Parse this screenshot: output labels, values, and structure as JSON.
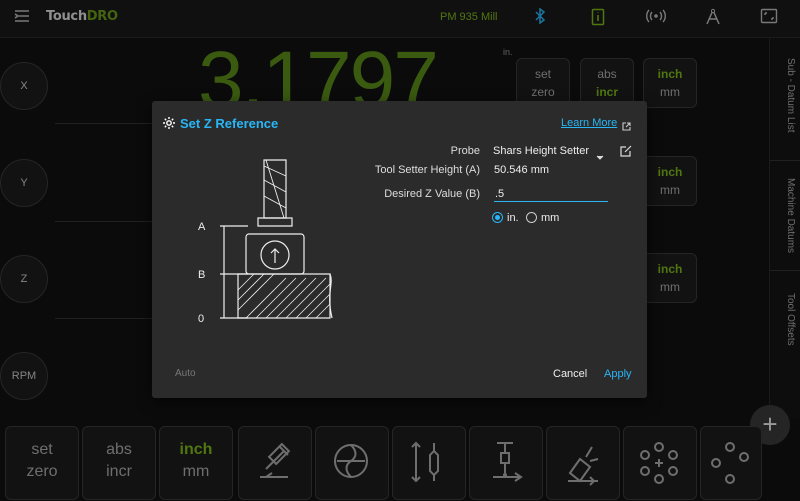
{
  "topbar": {
    "brand_main": "Touch",
    "brand_accent": "DRO",
    "machine_name": "PM 935 Mill"
  },
  "dro": {
    "axes": [
      "X",
      "Y",
      "Z",
      "RPM"
    ],
    "readout_x": "3.1797",
    "readout_unit": "in.",
    "side_buttons": [
      {
        "top": "set",
        "bottom": "zero"
      },
      {
        "top": "abs",
        "bottom": "incr"
      },
      {
        "top": "inch",
        "bottom": "mm"
      }
    ]
  },
  "rail": {
    "items": [
      "Sub - Datum List",
      "Machine Datums",
      "Tool Offsets"
    ]
  },
  "toolbar": {
    "set_top": "set",
    "set_bottom": "zero",
    "abs_top": "abs",
    "abs_bottom": "incr",
    "inch_top": "inch",
    "inch_bottom": "mm"
  },
  "dialog": {
    "title": "Set Z Reference",
    "learn_more": "Learn More",
    "probe_label": "Probe",
    "probe_value": "Shars Height Setter",
    "tool_setter_label": "Tool Setter Height (A)",
    "tool_setter_value": "50.546 mm",
    "desired_label": "Desired Z Value (B)",
    "desired_value": ".5",
    "unit_in": "in.",
    "unit_mm": "mm",
    "selected_unit": "in.",
    "diagram_labels": [
      "A",
      "B",
      "0"
    ],
    "auto": "Auto",
    "cancel": "Cancel",
    "apply": "Apply"
  },
  "colors": {
    "accent_blue": "#29b6f6",
    "accent_green": "#7cb518",
    "dialog_bg": "#2b2b2b",
    "app_bg": "#111111"
  },
  "icons": [
    "menu-icon",
    "bluetooth-icon",
    "info-icon",
    "wireless-icon",
    "compass-icon",
    "fullscreen-icon",
    "gear-icon",
    "external-link-icon",
    "edit-icon",
    "plus-icon"
  ]
}
